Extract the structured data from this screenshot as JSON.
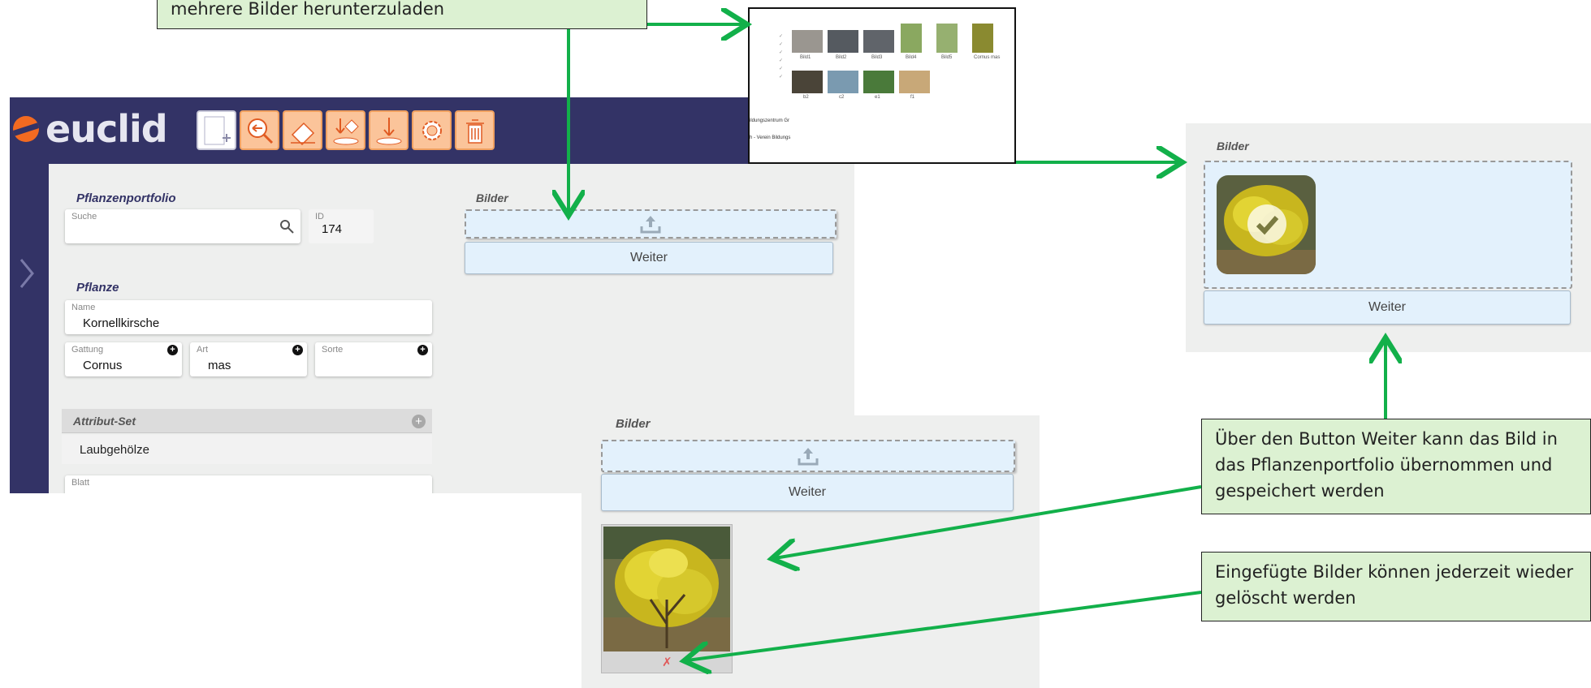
{
  "app": {
    "logo": "euclid",
    "toolbar": [
      "new-document-icon",
      "search-back-icon",
      "eraser-icon",
      "save-download-icon",
      "download-icon",
      "gear-icon",
      "trash-icon"
    ],
    "portfolio": {
      "title": "Pflanzenportfolio",
      "search_label": "Suche",
      "id_label": "ID",
      "id_value": "174"
    },
    "plant": {
      "title": "Pflanze",
      "name_label": "Name",
      "name_value": "Kornellkirsche",
      "genus_label": "Gattung",
      "genus_value": "Cornus",
      "species_label": "Art",
      "species_value": "mas",
      "variety_label": "Sorte",
      "variety_value": ""
    },
    "attribute_set": {
      "title": "Attribut-Set",
      "value": "Laubgehölze",
      "blatt_label": "Blatt"
    },
    "images": {
      "title": "Bilder",
      "weiter": "Weiter"
    }
  },
  "bottom_panel": {
    "title": "Bilder",
    "weiter": "Weiter",
    "delete": "✗"
  },
  "right_panel": {
    "title": "Bilder",
    "weiter": "Weiter"
  },
  "file_browser": {
    "files_row1": [
      "Bild1",
      "Bild2",
      "Bild3",
      "Bild4",
      "Bild5",
      "Cornus mas"
    ],
    "files_row2": [
      "b2",
      "c2",
      "e1",
      "f1"
    ],
    "sidebar": [
      "ildungszentrum Gr",
      "h - Verein Bildungs"
    ]
  },
  "callouts": {
    "top": "mehrere Bilder herunterzuladen",
    "weiter": "Über den Button Weiter kann das Bild in das Pflanzenportfolio übernommen und gespeichert werden",
    "delete": "Eingefügte Bilder können jederzeit wieder gelöscht werden"
  },
  "colors": {
    "header": "#333366",
    "panel_bg": "#eeefee",
    "button_bg": "#e3f1fc",
    "toolbar_btn": "#fbc49a",
    "callout_bg": "#dcf1d2",
    "arrow": "#12b04a"
  }
}
